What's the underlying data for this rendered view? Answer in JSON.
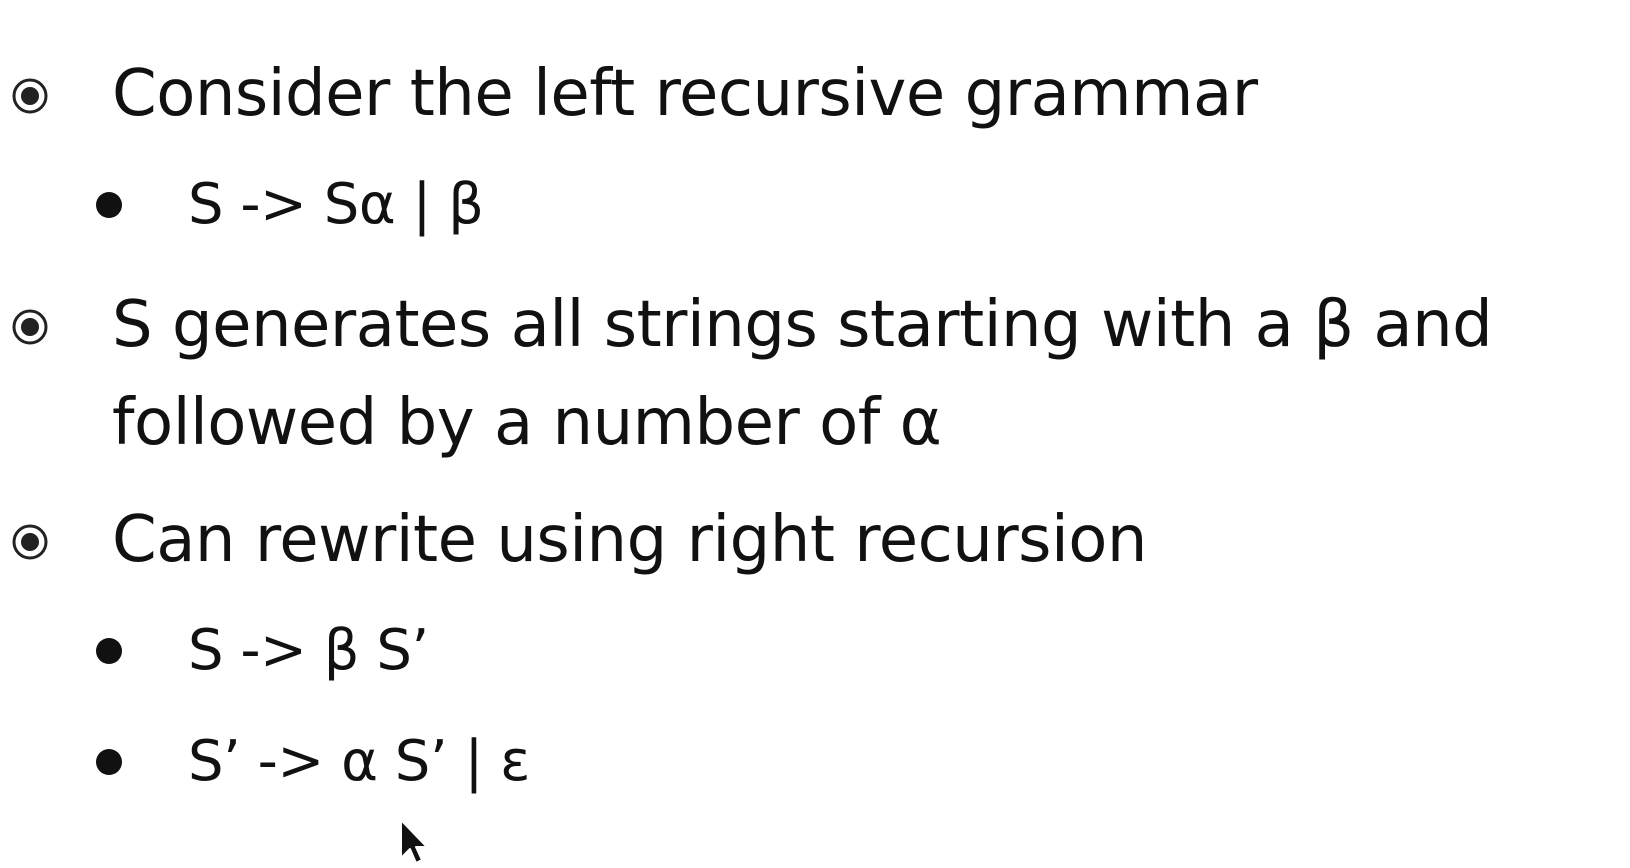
{
  "slide": {
    "items": [
      {
        "level": 1,
        "lines": [
          "Consider the left recursive grammar"
        ]
      },
      {
        "level": 2,
        "lines": [
          "S -> Sα | β"
        ]
      },
      {
        "level": 1,
        "lines": [
          "S generates all strings starting with a β and",
          "followed by a number of α"
        ]
      },
      {
        "level": 1,
        "lines": [
          "Can rewrite using right recursion"
        ]
      },
      {
        "level": 2,
        "lines": [
          "S -> β S’"
        ]
      },
      {
        "level": 2,
        "lines": [
          "S’ -> α S’ | ε"
        ]
      }
    ]
  },
  "icons": {
    "level1_bullet": "ringed-dot-bullet-icon",
    "level2_bullet": "filled-dot-bullet-icon",
    "cursor": "mouse-pointer-icon"
  },
  "colors": {
    "text": "#111111",
    "background": "#ffffff"
  }
}
